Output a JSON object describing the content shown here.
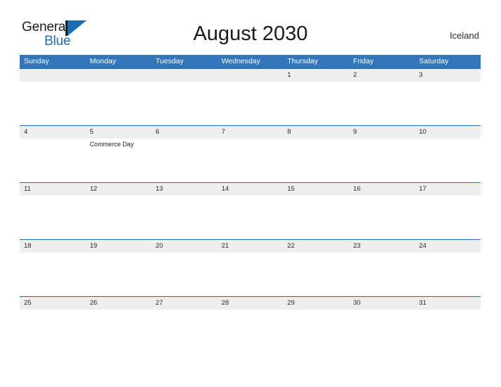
{
  "header": {
    "logo": {
      "word1": "General",
      "word2": "Blue",
      "mark_icon": "general-blue-flag-icon",
      "accent_color": "#1b6cb0"
    },
    "title": "August 2030",
    "locale": "Iceland"
  },
  "calendar": {
    "header_color": "#3275b8",
    "band_color": "#eeeeee",
    "row_line_color": "#2b6ca8",
    "weekday_headers": [
      "Sunday",
      "Monday",
      "Tuesday",
      "Wednesday",
      "Thursday",
      "Friday",
      "Saturday"
    ],
    "weeks": [
      [
        {
          "day": ""
        },
        {
          "day": ""
        },
        {
          "day": ""
        },
        {
          "day": ""
        },
        {
          "day": "1",
          "events": []
        },
        {
          "day": "2",
          "events": []
        },
        {
          "day": "3",
          "events": []
        }
      ],
      [
        {
          "day": "4",
          "events": []
        },
        {
          "day": "5",
          "events": [
            "Commerce Day"
          ]
        },
        {
          "day": "6",
          "events": []
        },
        {
          "day": "7",
          "events": []
        },
        {
          "day": "8",
          "events": []
        },
        {
          "day": "9",
          "events": []
        },
        {
          "day": "10",
          "events": []
        }
      ],
      [
        {
          "day": "11",
          "events": []
        },
        {
          "day": "12",
          "events": []
        },
        {
          "day": "13",
          "events": []
        },
        {
          "day": "14",
          "events": []
        },
        {
          "day": "15",
          "events": []
        },
        {
          "day": "16",
          "events": []
        },
        {
          "day": "17",
          "events": []
        }
      ],
      [
        {
          "day": "18",
          "events": []
        },
        {
          "day": "19",
          "events": []
        },
        {
          "day": "20",
          "events": []
        },
        {
          "day": "21",
          "events": []
        },
        {
          "day": "22",
          "events": []
        },
        {
          "day": "23",
          "events": []
        },
        {
          "day": "24",
          "events": []
        }
      ],
      [
        {
          "day": "25",
          "events": []
        },
        {
          "day": "26",
          "events": []
        },
        {
          "day": "27",
          "events": []
        },
        {
          "day": "28",
          "events": []
        },
        {
          "day": "29",
          "events": []
        },
        {
          "day": "30",
          "events": []
        },
        {
          "day": "31",
          "events": []
        }
      ]
    ]
  }
}
